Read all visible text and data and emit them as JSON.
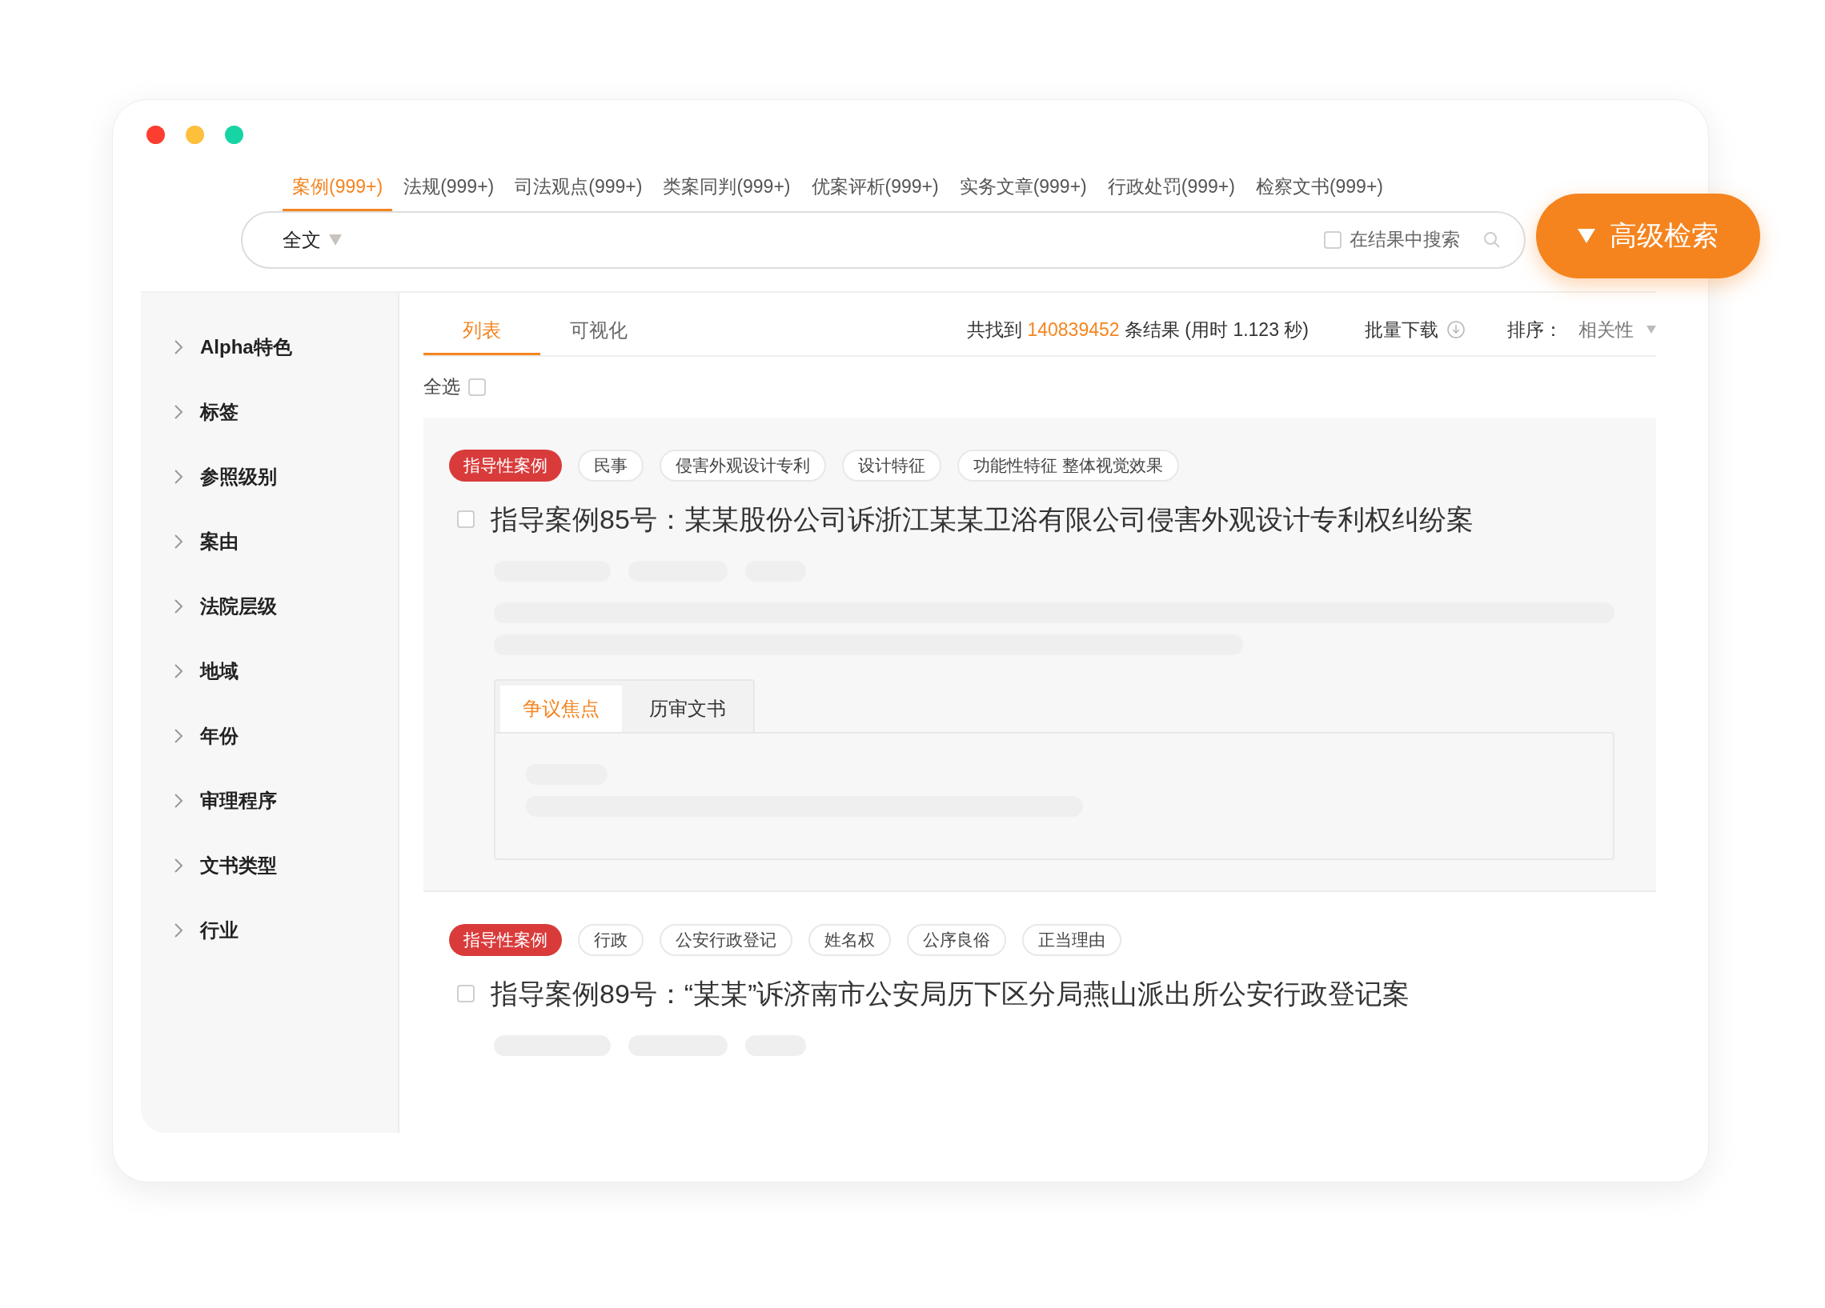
{
  "category_tabs": [
    {
      "label": "案例(999+)",
      "selected": true
    },
    {
      "label": "法规(999+)",
      "selected": false
    },
    {
      "label": "司法观点(999+)",
      "selected": false
    },
    {
      "label": "类案同判(999+)",
      "selected": false
    },
    {
      "label": "优案评析(999+)",
      "selected": false
    },
    {
      "label": "实务文章(999+)",
      "selected": false
    },
    {
      "label": "行政处罚(999+)",
      "selected": false
    },
    {
      "label": "检察文书(999+)",
      "selected": false
    }
  ],
  "search": {
    "scope": "全文",
    "in_results": {
      "label": "在结果中搜索",
      "checked": false
    }
  },
  "advanced_search_button": "高级检索",
  "sidebar": {
    "items": [
      {
        "label": "Alpha特色",
        "expanded": false
      },
      {
        "label": "标签",
        "expanded": false
      },
      {
        "label": "参照级别",
        "expanded": false
      },
      {
        "label": "案由",
        "expanded": false
      },
      {
        "label": "法院层级",
        "expanded": false
      },
      {
        "label": "地域",
        "expanded": false
      },
      {
        "label": "年份",
        "expanded": false
      },
      {
        "label": "审理程序",
        "expanded": false
      },
      {
        "label": "文书类型",
        "expanded": false
      },
      {
        "label": "行业",
        "expanded": false
      }
    ]
  },
  "results": {
    "view_tabs": [
      {
        "label": "列表",
        "selected": true
      },
      {
        "label": "可视化",
        "selected": false
      }
    ],
    "summary": {
      "prefix": "共找到",
      "count": "140839452",
      "suffix": "条结果 (用时 1.123 秒)"
    },
    "batch_download": "批量下载",
    "sort": {
      "label": "排序：",
      "value": "相关性"
    },
    "select_all": {
      "label": "全选",
      "checked": false
    },
    "cases": [
      {
        "highlighted": true,
        "checked": false,
        "tags": [
          {
            "label": "指导性案例",
            "kind": "primary"
          },
          {
            "label": "民事",
            "kind": "normal"
          },
          {
            "label": "侵害外观设计专利",
            "kind": "normal"
          },
          {
            "label": "设计特征",
            "kind": "normal"
          },
          {
            "label": "功能性特征 整体视觉效果",
            "kind": "normal"
          }
        ],
        "title": "指导案例85号：某某股份公司诉浙江某某卫浴有限公司侵害外观设计专利权纠纷案",
        "detail_tabs": [
          {
            "label": "争议焦点",
            "selected": true
          },
          {
            "label": "历审文书",
            "selected": false
          }
        ]
      },
      {
        "highlighted": false,
        "checked": false,
        "tags": [
          {
            "label": "指导性案例",
            "kind": "primary"
          },
          {
            "label": "行政",
            "kind": "normal"
          },
          {
            "label": "公安行政登记",
            "kind": "normal"
          },
          {
            "label": "姓名权",
            "kind": "normal"
          },
          {
            "label": "公序良俗",
            "kind": "normal"
          },
          {
            "label": "正当理由",
            "kind": "normal"
          }
        ],
        "title": "指导案例89号：“某某”诉济南市公安局历下区分局燕山派出所公安行政登记案"
      }
    ]
  }
}
